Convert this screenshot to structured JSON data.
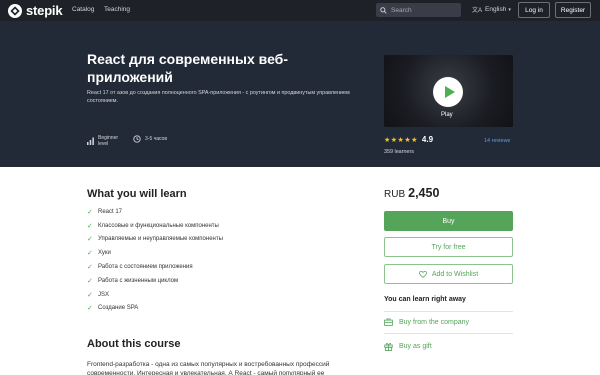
{
  "header": {
    "logo_text": "stepik",
    "nav": [
      "Catalog",
      "Teaching"
    ],
    "search_placeholder": "Search",
    "language": "English",
    "login_label": "Log in",
    "register_label": "Register"
  },
  "course": {
    "title": "React для современных веб-приложений",
    "description": "React 17 от азов до создания полноценного SPA-приложения - с роутингом и продвинутым управлением состоянием.",
    "level_line1": "Beginner",
    "level_line2": "level",
    "duration": "3-5 часов",
    "video_label": "Play",
    "rating": "4.9",
    "rating_stars": 5,
    "reviews": "14 reviews",
    "learners": "359 learners"
  },
  "learn": {
    "heading": "What you will learn",
    "items": [
      "React 17",
      "Классовые и функциональные компоненты",
      "Управляемые и неуправляемые компоненты",
      "Хуки",
      "Работа с состоянием приложения",
      "Работа с жизненным циклом",
      "JSX",
      "Создание SPA"
    ]
  },
  "about": {
    "heading": "About this course",
    "text": "Frontend-разработка - одна из самых популярных и востребованных профессий современности. Интересная и увлекательная. А React - самый популярный ее"
  },
  "purchase": {
    "currency": "RUB",
    "price": "2,450",
    "buy_label": "Buy",
    "try_label": "Try for free",
    "wishlist_label": "Add to Wishlist",
    "learn_right_away": "You can learn right away",
    "company_label": "Buy from the company",
    "gift_label": "Buy as gift"
  },
  "colors": {
    "accent": "#54a45a",
    "hero_bg": "#232a37",
    "topbar_bg": "#1f2129",
    "star": "#f5c32c",
    "link": "#59a0e8"
  }
}
